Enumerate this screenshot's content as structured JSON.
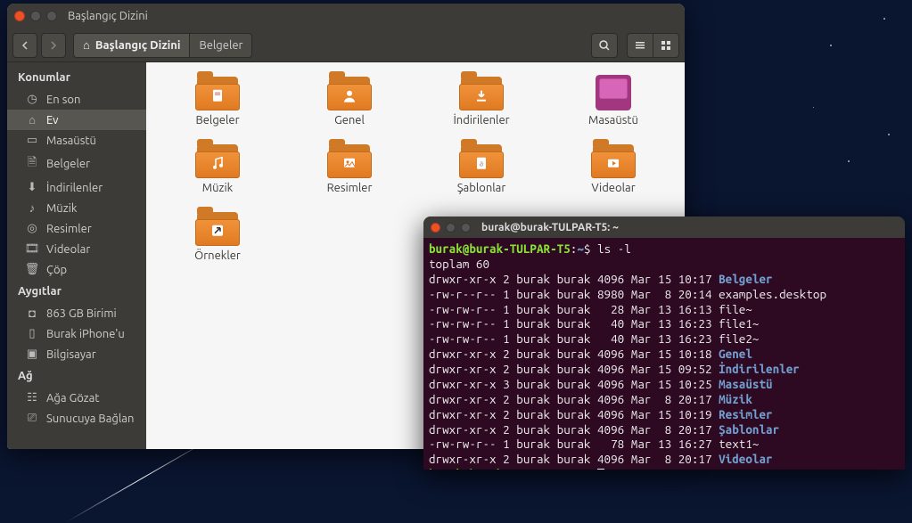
{
  "fm": {
    "window_title": "Başlangıç Dizini",
    "path_home": "Başlangıç Dizini",
    "path_current": "Belgeler",
    "sidebar": {
      "places_header": "Konumlar",
      "items": [
        {
          "label": "En son"
        },
        {
          "label": "Ev"
        },
        {
          "label": "Masaüstü"
        },
        {
          "label": "Belgeler"
        },
        {
          "label": "İndirilenler"
        },
        {
          "label": "Müzik"
        },
        {
          "label": "Resimler"
        },
        {
          "label": "Videolar"
        },
        {
          "label": "Çöp"
        }
      ],
      "devices_header": "Aygıtlar",
      "devices": [
        {
          "label": "863 GB Birimi"
        },
        {
          "label": "Burak iPhone'u"
        },
        {
          "label": "Bilgisayar"
        }
      ],
      "network_header": "Ağ",
      "network": [
        {
          "label": "Ağa Gözat"
        },
        {
          "label": "Sunucuya Bağlan"
        }
      ]
    },
    "folders": [
      {
        "label": "Belgeler",
        "emblem": "doc"
      },
      {
        "label": "Genel",
        "emblem": "person"
      },
      {
        "label": "İndirilenler",
        "emblem": "down"
      },
      {
        "label": "Masaüstü",
        "emblem": "desktop"
      },
      {
        "label": "Müzik",
        "emblem": "music"
      },
      {
        "label": "Resimler",
        "emblem": "image"
      },
      {
        "label": "Şablonlar",
        "emblem": "template"
      },
      {
        "label": "Videolar",
        "emblem": "video"
      },
      {
        "label": "Örnekler",
        "emblem": "link"
      }
    ]
  },
  "term": {
    "title": "burak@burak-TULPAR-T5: ~",
    "prompt_user": "burak@burak-TULPAR-T5",
    "prompt_path": "~",
    "cmd": "ls -l",
    "total_label": "toplam 60",
    "rows": [
      {
        "perm": "drwxr-xr-x",
        "links": "2",
        "user": "burak",
        "group": "burak",
        "size": "4096",
        "date": "Mar 15 10:17",
        "name": "Belgeler",
        "dir": true
      },
      {
        "perm": "-rw-r--r--",
        "links": "1",
        "user": "burak",
        "group": "burak",
        "size": "8980",
        "date": "Mar  8 20:14",
        "name": "examples.desktop",
        "dir": false
      },
      {
        "perm": "-rw-rw-r--",
        "links": "1",
        "user": "burak",
        "group": "burak",
        "size": "  28",
        "date": "Mar 13 16:13",
        "name": "file~",
        "dir": false
      },
      {
        "perm": "-rw-rw-r--",
        "links": "1",
        "user": "burak",
        "group": "burak",
        "size": "  40",
        "date": "Mar 13 16:23",
        "name": "file1~",
        "dir": false
      },
      {
        "perm": "-rw-rw-r--",
        "links": "1",
        "user": "burak",
        "group": "burak",
        "size": "  40",
        "date": "Mar 13 16:23",
        "name": "file2~",
        "dir": false
      },
      {
        "perm": "drwxr-xr-x",
        "links": "2",
        "user": "burak",
        "group": "burak",
        "size": "4096",
        "date": "Mar 15 10:18",
        "name": "Genel",
        "dir": true
      },
      {
        "perm": "drwxr-xr-x",
        "links": "2",
        "user": "burak",
        "group": "burak",
        "size": "4096",
        "date": "Mar 15 09:52",
        "name": "İndirilenler",
        "dir": true
      },
      {
        "perm": "drwxr-xr-x",
        "links": "3",
        "user": "burak",
        "group": "burak",
        "size": "4096",
        "date": "Mar 15 10:25",
        "name": "Masaüstü",
        "dir": true
      },
      {
        "perm": "drwxr-xr-x",
        "links": "2",
        "user": "burak",
        "group": "burak",
        "size": "4096",
        "date": "Mar  8 20:17",
        "name": "Müzik",
        "dir": true
      },
      {
        "perm": "drwxr-xr-x",
        "links": "2",
        "user": "burak",
        "group": "burak",
        "size": "4096",
        "date": "Mar 15 10:19",
        "name": "Resimler",
        "dir": true
      },
      {
        "perm": "drwxr-xr-x",
        "links": "2",
        "user": "burak",
        "group": "burak",
        "size": "4096",
        "date": "Mar  8 20:17",
        "name": "Şablonlar",
        "dir": true
      },
      {
        "perm": "-rw-rw-r--",
        "links": "1",
        "user": "burak",
        "group": "burak",
        "size": "  78",
        "date": "Mar 13 16:27",
        "name": "text1~",
        "dir": false
      },
      {
        "perm": "drwxr-xr-x",
        "links": "2",
        "user": "burak",
        "group": "burak",
        "size": "4096",
        "date": "Mar  8 20:17",
        "name": "Videolar",
        "dir": true
      }
    ]
  }
}
